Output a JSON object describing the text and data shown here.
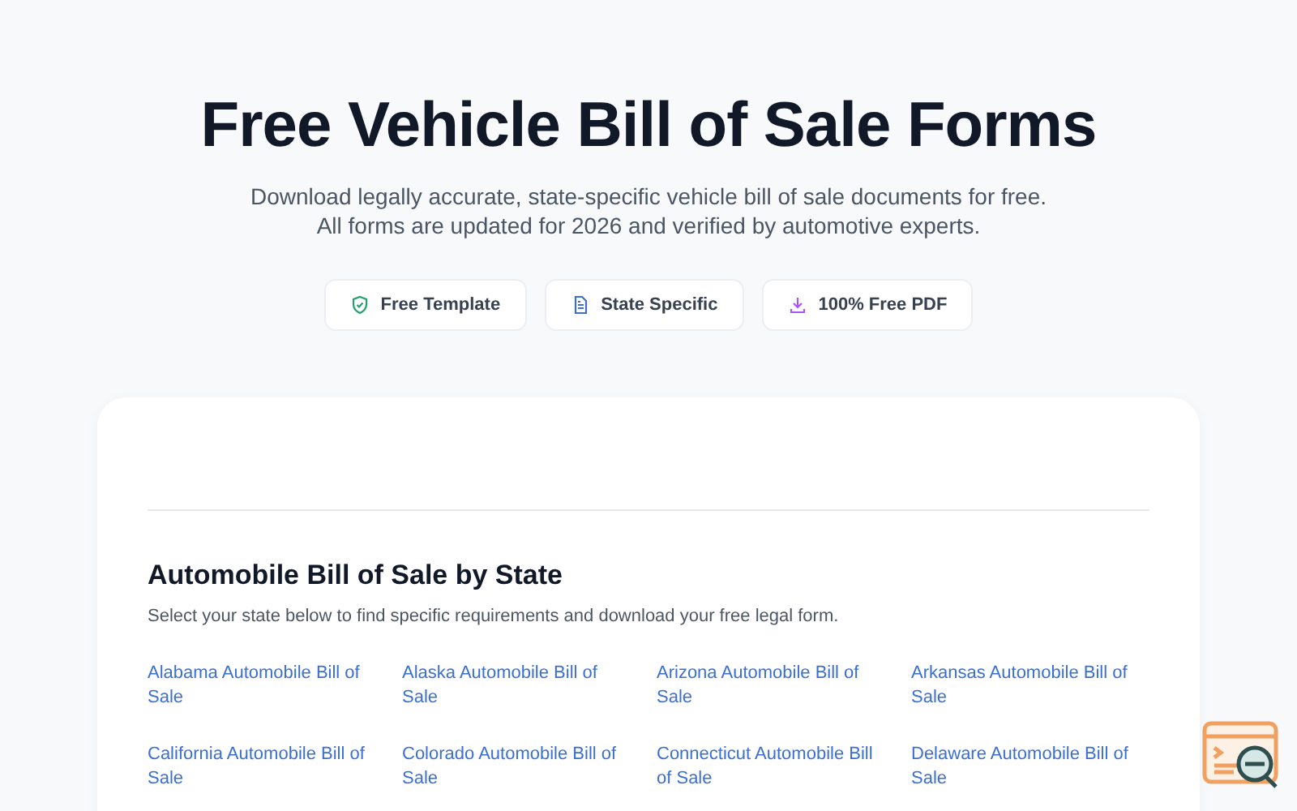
{
  "hero": {
    "title": "Free Vehicle Bill of Sale Forms",
    "subtitle_lines": [
      "Download legally accurate, state-specific vehicle bill of sale documents for free.",
      "All forms are updated for 2026 and verified by automotive experts."
    ]
  },
  "badges": [
    {
      "kind": "shield",
      "label": "Free Template"
    },
    {
      "kind": "document",
      "label": "State Specific"
    },
    {
      "kind": "download",
      "label": "100% Free PDF"
    }
  ],
  "section": {
    "title": "Automobile Bill of Sale by State",
    "description": "Select your state below to find specific requirements and download your free legal form.",
    "links": [
      "Alabama Automobile Bill of Sale",
      "Alaska Automobile Bill of Sale",
      "Arizona Automobile Bill of Sale",
      "Arkansas Automobile Bill of Sale",
      "California Automobile Bill of Sale",
      "Colorado Automobile Bill of Sale",
      "Connecticut Automobile Bill of Sale",
      "Delaware Automobile Bill of Sale"
    ]
  }
}
